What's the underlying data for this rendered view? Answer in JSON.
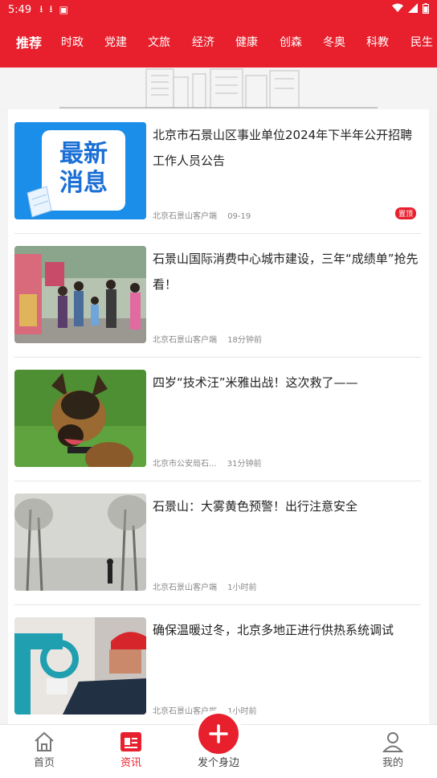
{
  "status_bar": {
    "time": "5:49"
  },
  "tabs": [
    "推荐",
    "时政",
    "党建",
    "文旅",
    "经济",
    "健康",
    "创森",
    "冬奥",
    "科教",
    "民生"
  ],
  "thumb_text": {
    "line1": "最新",
    "line2": "消息"
  },
  "news": [
    {
      "title": "北京市石景山区事业单位2024年下半年公开招聘工作人员公告",
      "source": "北京石景山客户端",
      "time": "09-19",
      "badge": "置顶"
    },
    {
      "title": "石景山国际消费中心城市建设，三年“成绩单”抢先看！",
      "source": "北京石景山客户端",
      "time": "18分钟前"
    },
    {
      "title": "四岁“技术汪”米雅出战！这次救了——",
      "source": "北京市公安局石...",
      "time": "31分钟前"
    },
    {
      "title": "石景山：大雾黄色预警！出行注意安全",
      "source": "北京石景山客户端",
      "time": "1小时前"
    },
    {
      "title": "确保温暖过冬，北京多地正进行供热系统调试",
      "source": "北京石景山客户端",
      "time": "1小时前"
    }
  ],
  "bottom_nav": {
    "home": "首页",
    "news": "资讯",
    "post": "发个身边",
    "mine": "我的"
  },
  "colors": {
    "brand": "#e8202d"
  }
}
